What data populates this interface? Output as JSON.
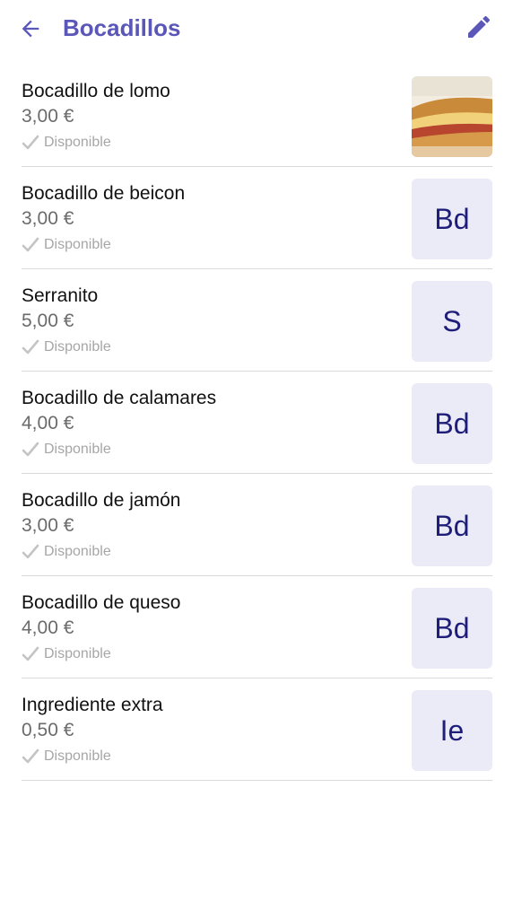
{
  "header": {
    "title": "Bocadillos",
    "back_icon": "arrow-back-icon",
    "edit_icon": "pencil-icon",
    "accent_color": "#5b57b8"
  },
  "items": [
    {
      "name": "Bocadillo de lomo",
      "price": "3,00 €",
      "status": "Disponible",
      "thumb_type": "photo",
      "initials": ""
    },
    {
      "name": "Bocadillo de beicon",
      "price": "3,00 €",
      "status": "Disponible",
      "thumb_type": "initials",
      "initials": "Bd"
    },
    {
      "name": "Serranito",
      "price": "5,00 €",
      "status": "Disponible",
      "thumb_type": "initials",
      "initials": "S"
    },
    {
      "name": "Bocadillo de calamares",
      "price": "4,00 €",
      "status": "Disponible",
      "thumb_type": "initials",
      "initials": "Bd"
    },
    {
      "name": "Bocadillo de jamón",
      "price": "3,00 €",
      "status": "Disponible",
      "thumb_type": "initials",
      "initials": "Bd"
    },
    {
      "name": "Bocadillo de queso",
      "price": "4,00 €",
      "status": "Disponible",
      "thumb_type": "initials",
      "initials": "Bd"
    },
    {
      "name": "Ingrediente extra",
      "price": "0,50 €",
      "status": "Disponible",
      "thumb_type": "initials",
      "initials": "Ie"
    }
  ]
}
